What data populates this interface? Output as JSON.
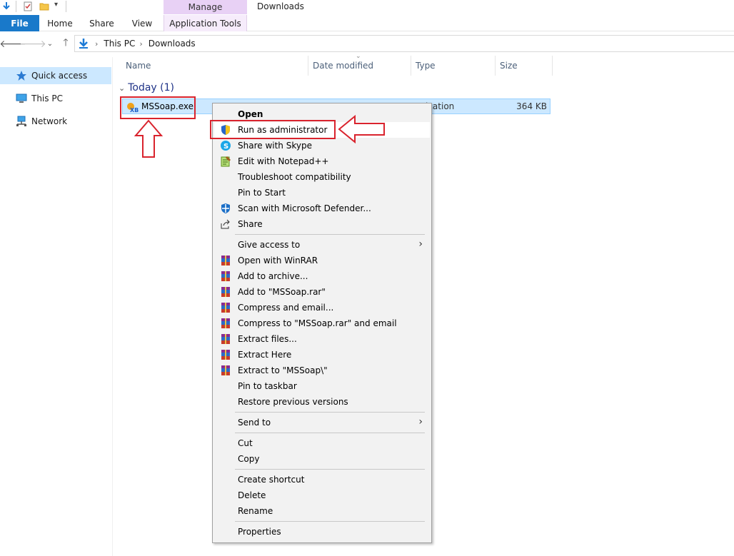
{
  "ribbon": {
    "tabs": {
      "file": "File",
      "home": "Home",
      "share": "Share",
      "view": "View"
    },
    "contextual": {
      "group": "Manage",
      "tab": "Application Tools"
    },
    "window_title": "Downloads"
  },
  "address": {
    "crumbs": [
      "This PC",
      "Downloads"
    ]
  },
  "sidebar": {
    "items": [
      {
        "label": "Quick access",
        "icon": "star-icon"
      },
      {
        "label": "This PC",
        "icon": "computer-icon"
      },
      {
        "label": "Network",
        "icon": "network-icon"
      }
    ]
  },
  "columns": {
    "name": "Name",
    "date": "Date modified",
    "type": "Type",
    "size": "Size"
  },
  "group": {
    "label": "Today (1)"
  },
  "file": {
    "name": "MSSoap.exe",
    "type": "ication",
    "size": "364 KB"
  },
  "context_menu": {
    "items": [
      {
        "label": "Open",
        "icon": ""
      },
      {
        "label": "Run as administrator",
        "icon": "shield-icon"
      },
      {
        "label": "Share with Skype",
        "icon": "skype-icon"
      },
      {
        "label": "Edit with Notepad++",
        "icon": "notepadpp-icon"
      },
      {
        "label": "Troubleshoot compatibility",
        "icon": ""
      },
      {
        "label": "Pin to Start",
        "icon": ""
      },
      {
        "label": "Scan with Microsoft Defender...",
        "icon": "defender-icon"
      },
      {
        "label": "Share",
        "icon": "share-icon"
      },
      {
        "label": "Give access to",
        "icon": ""
      },
      {
        "label": "Open with WinRAR",
        "icon": "winrar-icon"
      },
      {
        "label": "Add to archive...",
        "icon": "winrar-icon"
      },
      {
        "label": "Add to \"MSSoap.rar\"",
        "icon": "winrar-icon"
      },
      {
        "label": "Compress and email...",
        "icon": "winrar-icon"
      },
      {
        "label": "Compress to \"MSSoap.rar\" and email",
        "icon": "winrar-icon"
      },
      {
        "label": "Extract files...",
        "icon": "winrar-icon"
      },
      {
        "label": "Extract Here",
        "icon": "winrar-icon"
      },
      {
        "label": "Extract to \"MSSoap\\\"",
        "icon": "winrar-icon"
      },
      {
        "label": "Pin to taskbar",
        "icon": ""
      },
      {
        "label": "Restore previous versions",
        "icon": ""
      },
      {
        "label": "Send to",
        "icon": ""
      },
      {
        "label": "Cut",
        "icon": ""
      },
      {
        "label": "Copy",
        "icon": ""
      },
      {
        "label": "Create shortcut",
        "icon": ""
      },
      {
        "label": "Delete",
        "icon": ""
      },
      {
        "label": "Rename",
        "icon": ""
      },
      {
        "label": "Properties",
        "icon": ""
      }
    ]
  },
  "colors": {
    "file_tab": "#1979ca",
    "selection": "#cce8ff",
    "manage_context": "#e8d1f5",
    "annotation": "#d9232d"
  }
}
